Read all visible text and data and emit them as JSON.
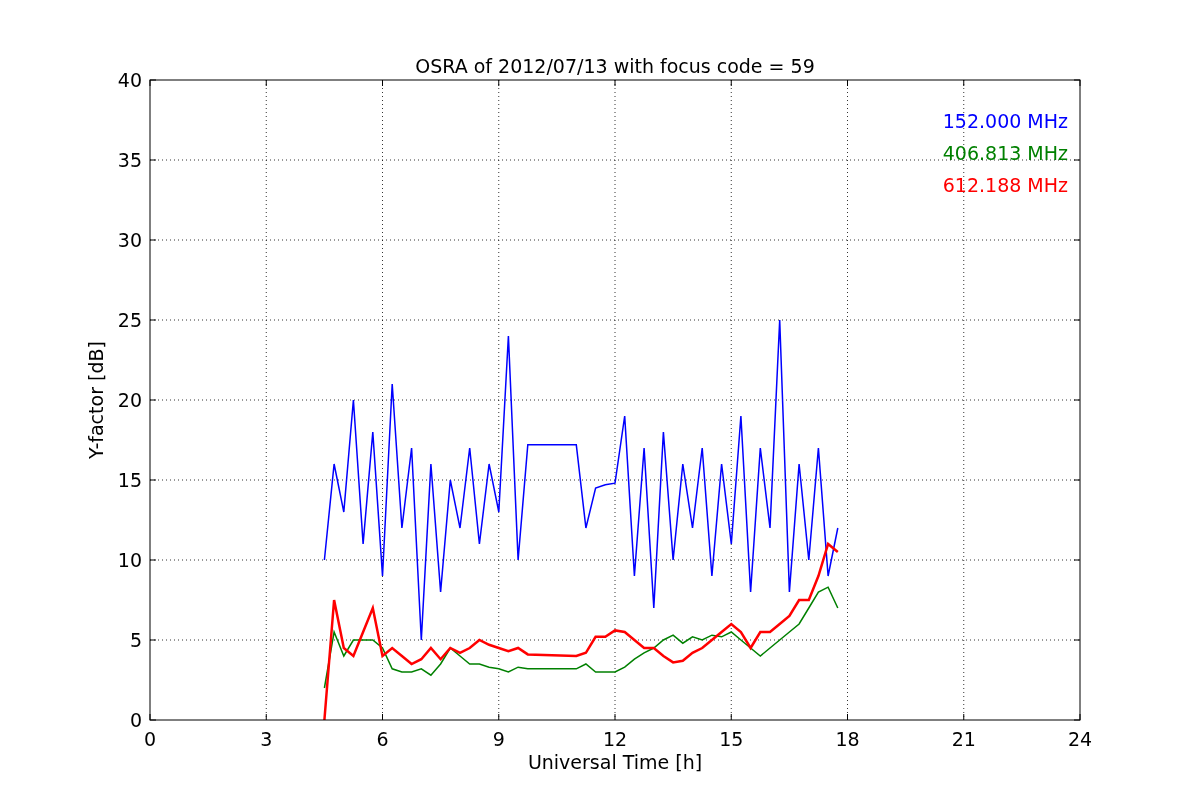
{
  "chart_data": {
    "type": "line",
    "title": "OSRA of 2012/07/13 with focus code = 59",
    "xlabel": "Universal Time [h]",
    "ylabel": "Y-factor [dB]",
    "x": [
      4.5,
      4.75,
      5,
      5.25,
      5.5,
      5.75,
      6,
      6.25,
      6.5,
      6.75,
      7,
      7.25,
      7.5,
      7.75,
      8,
      8.25,
      8.5,
      8.75,
      9,
      9.25,
      9.5,
      9.75,
      11,
      11.25,
      11.5,
      11.75,
      12,
      12.25,
      12.5,
      12.75,
      13,
      13.25,
      13.5,
      13.75,
      14,
      14.25,
      14.5,
      14.75,
      15,
      15.25,
      15.5,
      15.75,
      16,
      16.25,
      16.5,
      16.75,
      17,
      17.25,
      17.5,
      17.75
    ],
    "series": [
      {
        "name": "152.000 MHz",
        "color": "#0000ff",
        "values": [
          10,
          16,
          13,
          20,
          11,
          18,
          9,
          21,
          12,
          17,
          5,
          16,
          8,
          15,
          12,
          17,
          11,
          16,
          13,
          24,
          10,
          17.2,
          17.2,
          12,
          14.5,
          14.7,
          14.8,
          19,
          9,
          17,
          7,
          18,
          10,
          16,
          12,
          17,
          9,
          16,
          11,
          19,
          8,
          17,
          12,
          25,
          8,
          16,
          10,
          17,
          9,
          12
        ]
      },
      {
        "name": "406.813 MHz",
        "color": "#008000",
        "values": [
          2,
          5.5,
          4,
          5,
          5,
          5,
          4.5,
          3.2,
          3,
          3,
          3.2,
          2.8,
          3.5,
          4.5,
          4,
          3.5,
          3.5,
          3.3,
          3.2,
          3,
          3.3,
          3.2,
          3.2,
          3.5,
          3,
          3,
          3,
          3.3,
          3.8,
          4.2,
          4.5,
          5,
          5.3,
          4.8,
          5.2,
          5,
          5.3,
          5.2,
          5.5,
          5,
          4.5,
          4,
          4.5,
          5,
          5.5,
          6,
          7,
          8,
          8.3,
          7
        ]
      },
      {
        "name": "612.188 MHz",
        "color": "#ff0000",
        "values": [
          0,
          7.5,
          4.5,
          4,
          5.5,
          7,
          4,
          4.5,
          4,
          3.5,
          3.8,
          4.5,
          3.8,
          4.5,
          4.2,
          4.5,
          5,
          4.7,
          4.5,
          4.3,
          4.5,
          4.1,
          4,
          4.2,
          5.2,
          5.2,
          5.6,
          5.5,
          5,
          4.5,
          4.5,
          4,
          3.6,
          3.7,
          4.2,
          4.5,
          5,
          5.5,
          6,
          5.5,
          4.5,
          5.5,
          5.5,
          6,
          6.5,
          7.5,
          7.5,
          9,
          11,
          10.5
        ]
      }
    ],
    "grid": true,
    "xlim": [
      0,
      24
    ],
    "ylim": [
      0,
      40
    ],
    "xticks": [
      0,
      3,
      6,
      9,
      12,
      15,
      18,
      21,
      24
    ],
    "yticks": [
      0,
      5,
      10,
      15,
      20,
      25,
      30,
      35,
      40
    ]
  }
}
